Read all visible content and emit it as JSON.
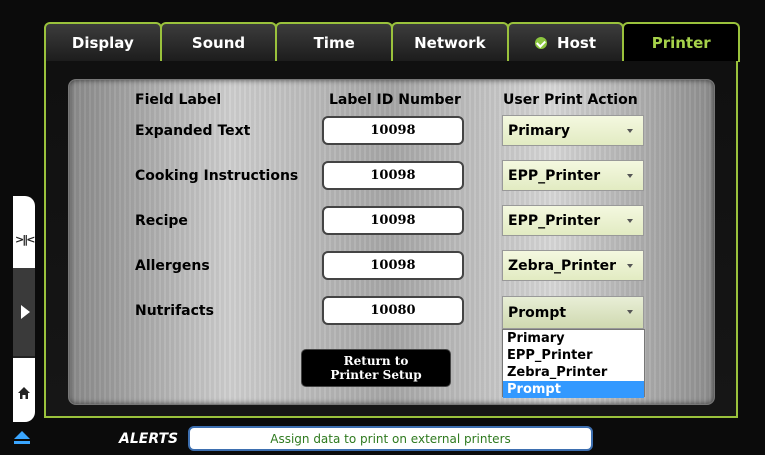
{
  "tabs": [
    {
      "label": "Display"
    },
    {
      "label": "Sound"
    },
    {
      "label": "Time"
    },
    {
      "label": "Network"
    },
    {
      "label": "Host",
      "status_icon": "check-circle-icon"
    },
    {
      "label": "Printer",
      "active": true
    }
  ],
  "table": {
    "headers": {
      "field_label": "Field Label",
      "label_id": "Label ID Number",
      "action": "User Print Action"
    },
    "rows": [
      {
        "field": "Expanded Text",
        "id": "10098",
        "action": "Primary"
      },
      {
        "field": "Cooking Instructions",
        "id": "10098",
        "action": "EPP_Printer"
      },
      {
        "field": "Recipe",
        "id": "10098",
        "action": "EPP_Printer"
      },
      {
        "field": "Allergens",
        "id": "10098",
        "action": "Zebra_Printer"
      },
      {
        "field": "Nutrifacts",
        "id": "10080",
        "action": "Prompt"
      }
    ]
  },
  "dropdown": {
    "options": [
      "Primary",
      "EPP_Printer",
      "Zebra_Printer",
      "Prompt"
    ],
    "highlighted": "Prompt"
  },
  "return_button": {
    "line1": "Return to",
    "line2": "Printer Setup"
  },
  "side_controls": {
    "icons": [
      "expand-icon",
      "play-arrow-icon",
      "home-icon",
      "eject-icon"
    ]
  },
  "alerts": {
    "label": "ALERTS",
    "message": "Assign data to print on external printers"
  },
  "colors": {
    "accent": "#9ac23c",
    "active_tab_text": "#a6d24a",
    "highlight": "#3399ff",
    "alert_text": "#2f7a1f"
  }
}
